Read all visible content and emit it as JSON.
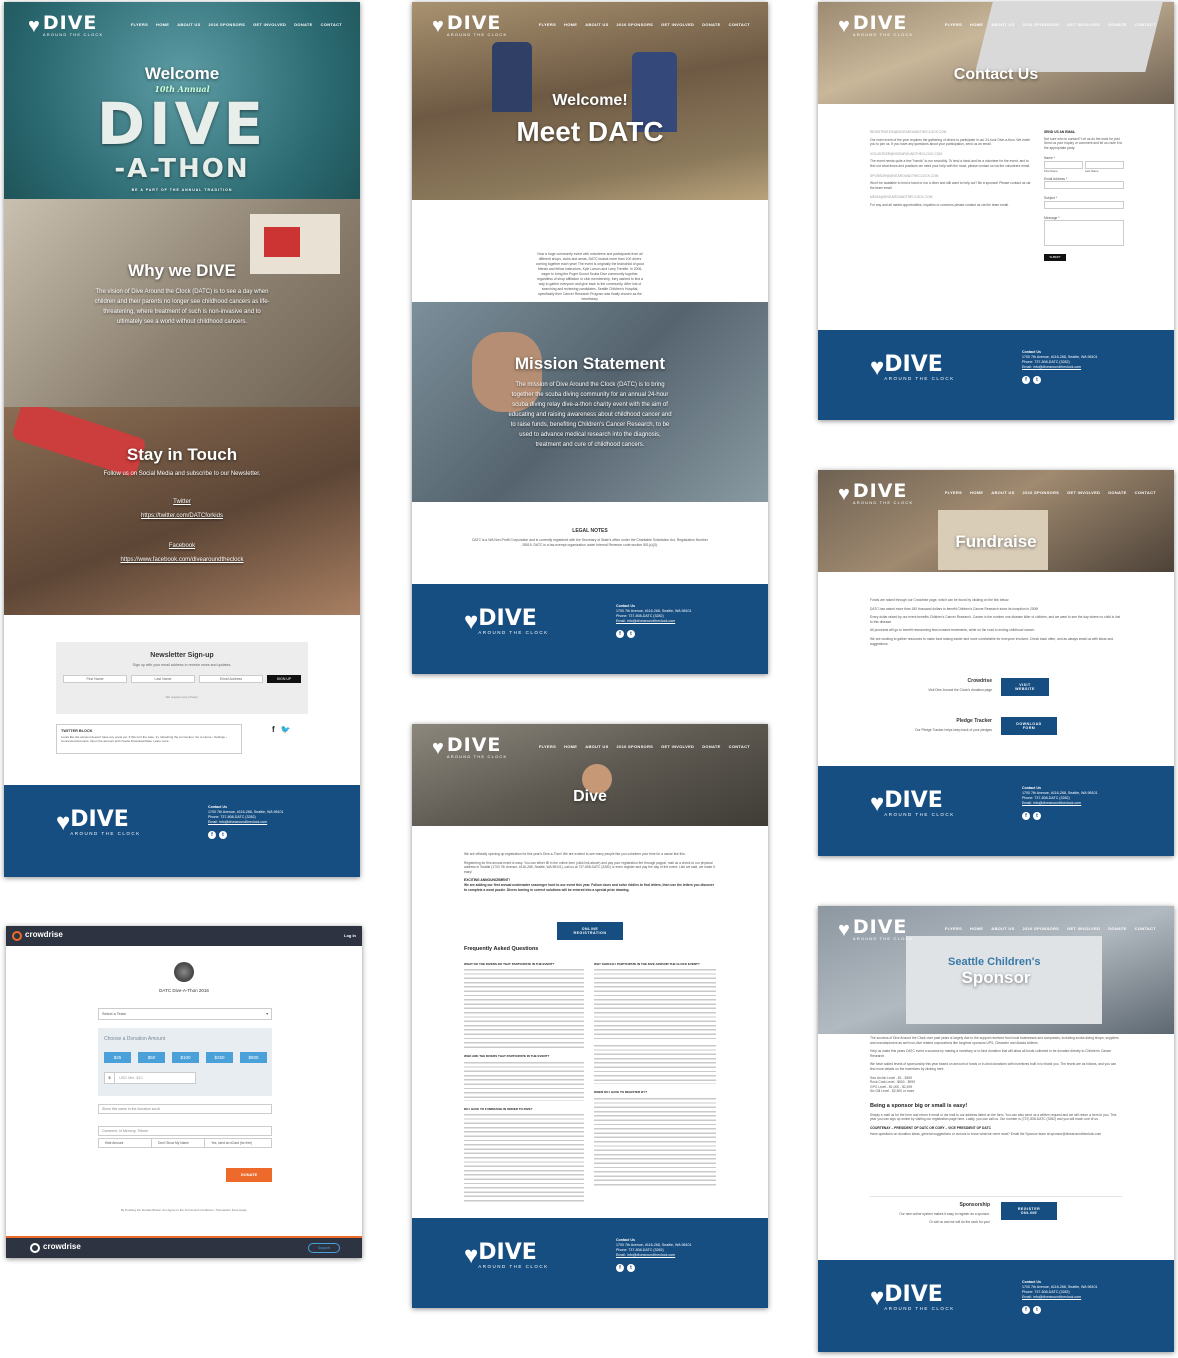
{
  "brand": {
    "name": "DIVE",
    "tagline": "AROUND THE CLOCK"
  },
  "nav": [
    "FLYERS",
    "HOME",
    "ABOUT US",
    "2016 SPONSORS",
    "GET INVOLVED",
    "DONATE",
    "CONTACT"
  ],
  "home": {
    "welcome": "Welcome",
    "annual": "10th Annual",
    "dive": "DIVE",
    "athon": "-A-THON",
    "be_part": "BE A PART OF THE ANNUAL TRADITION",
    "why_title": "Why we DIVE",
    "why_text": "The vision of Dive Around the Clock (DATC) is to see a day when children and their parents no longer see childhood cancers as life-threatening, where treatment of such is non-invasive and to ultimately see a world without childhood cancers.",
    "stay_title": "Stay in Touch",
    "stay_text": "Follow us on Social Media and subscribe to our Newsletter.",
    "twitter_label": "Twitter",
    "twitter_url": "https://twitter.com/DATCforkids",
    "facebook_label": "Facebook",
    "facebook_url": "https://www.facebook.com/divearoundtheclock",
    "newsletter_title": "Newsletter Sign-up",
    "newsletter_text": "Sign up with your email address to receive news and updates.",
    "first_name": "First Name",
    "last_name": "Last Name",
    "email_address": "Email Address",
    "signup": "SIGN UP",
    "privacy": "We respect your privacy.",
    "twitter_block_title": "TWITTER BLOCK",
    "twitter_block_text": "Looks like the account doesn't have any posts yet. If this isn't the case, try refreshing the connection. Go to Home › Settings › Connected Accounts. Open the account and choose Download Data. Learn more."
  },
  "about": {
    "welcome": "Welcome!",
    "title": "Meet DATC",
    "intro": "Now a huge community event with volunteers and participants from all different shops, clubs and areas, DATC boasts more than 100 divers coming together each year! The event is originally the brainchild of good friends and fellow instructors, Kyle Larson and Larry Trendle. In 2006, eager to bring the Puget Sound Scuba Dive community together, regardless of shop affiliation or club membership, they wanted to find a way to gather everyone and give back to the community. After lots of searching and reviewing candidates, Seattle Children's Hospital, specifically their Cancer Research Program was finally chosen as the beneficiary.",
    "mission_title": "Mission Statement",
    "mission_text": "The mission of Dive Around the Clock (DATC) is to bring together the scuba diving community for an annual 24-hour scuba diving relay dive-a-thon charity event with the aim of educating and raising awareness about childhood cancer and to raise funds, benefiting Children's Cancer Research, to be used to advance medical research into the diagnosis, treatment and cure of childhood cancers.",
    "legal_title": "LEGAL NOTES",
    "legal_text": "DATC is a WA Non-Profit Corporation and is currently registered with the Secretary of State's office under the Charitable Solicitation Act. Registration Number 28519. DATC is a tax-exempt organization under Internal Revenue code section 501(c)(3)."
  },
  "footer": {
    "contact_label": "Contact Us",
    "address": "1700 7th Avenue, #116-268, Seattle, WA 98101",
    "phone": "Phone: 737-808-DATC (3282)",
    "email": "Email: info@divearoundtheclock.com"
  },
  "contact": {
    "title": "Contact Us",
    "reg_email": "REGISTRATION@DIVEAROUNDTHECLOCK.COM",
    "reg_text": "Our main event of the year requires the gathering of divers to participate in our 24-hour Dive-a-thon. We invite you to join us. If you have any questions about your participation, send us an email.",
    "vol_email": "VOLUNTEER@DIVEAROUNDTHECLOCK.COM",
    "vol_text": "The event needs quite a few \"hands\" to run smoothly. To lend a hand and be a volunteer for the event, and to find out what times and positions we need your help with the most, please contact us via the volunteers email.",
    "spo_email": "SPONSOR@DIVEAROUNDTHECLOCK.COM",
    "spo_text": "Won't be available to lend a hand or run a diver and still want to help out? Be a sponsor! Please contact us via the team email.",
    "med_email": "MEDIA@DIVEAROUNDTHECLOCK.COM",
    "med_text": "For any and all media opportunities, inquiries or concerns please contact us via the team email.",
    "send_title": "SEND US AN EMAIL",
    "send_text": "Not sure who to contact? Let us do the work for you! Send us your inquiry or comment and let us route it to the appropriate party.",
    "name": "Name *",
    "first": "First Name",
    "last": "Last Name",
    "email": "Email Address *",
    "subject": "Subject *",
    "message": "Message *",
    "submit": "SUBMIT"
  },
  "fundraise": {
    "title": "Fundraise",
    "p1": "Funds are raised through our Crowdrise page, which can be found by clicking on the link below.",
    "p2": "DATC has raised more than 180 thousand dollars to benefit Children's Cancer Research since its inception in 2006!",
    "p3": "Every dollar raised by our event benefits Children's Cancer Research. Cancer is the number one disease killer of children, and we want to see the day where no child is lost to this disease.",
    "p4": "All proceeds will go to benefit researching less invasive treatments, while on the road to ending childhood cancer.",
    "p5": "We are working to gather resources to make fund raising easier and more comfortable for everyone involved. Check back often, and as always email us with ideas and suggestions.",
    "crowdrise_title": "Crowdrise",
    "crowdrise_text": "Visit Dive Around the Clock's donation page",
    "visit": "VISIT WEBSITE",
    "pledge_title": "Pledge Tracker",
    "pledge_text": "Our Pledge Tracker helps keep track of your pledges",
    "download": "DOWNLOAD FORM"
  },
  "dive": {
    "title": "Dive",
    "p1": "We are officially opening up registration for this year's Dive-a-Thon! We are excited to see many people like you volunteer your time for a cause like this.",
    "p2": "Registering for this annual event is easy. You can either fill in the online form (click link above) and pay your registration fee through paypal, mail us a check to our physical address in Seattle (1700 7th Avenue, #116-268, Seattle, WA 98101), call us at 737-808-DATC (3282) or even register and pay the day of the event. Like we said, we make it easy!",
    "exciting": "EXCITING ANNOUNCEMENT!",
    "p3": "We are adding our first annual underwater scavenger hunt to our event this year. Follow clues and solve riddles to find letters, then use the letters you discover to complete a word puzzle. Divers turning in correct solutions will be entered into a special prize drawing.",
    "register": "ONLINE REGISTRATION",
    "faq": "Frequently Asked Questions",
    "q1": "WHAT DO THE DIVERS DO THAT PARTICIPATE IN THE EVENT?",
    "q2": "WHY SHOULD I PARTICIPATE IN THE DIVE AROUND THE CLOCK EVENT?",
    "q3": "WHO ARE THE DIVERS THAT PARTICIPATE IN THE EVENT?",
    "q4": "WHO ELSE PARTICIPATES IN THE EVENT?",
    "q5": "DO I HAVE TO FUNDRAISE IN ORDER TO DIVE?",
    "q6": "WHEN DO I HAVE TO REGISTER BY?"
  },
  "sponsor": {
    "title": "Sponsor",
    "bg_sign": "Seattle Children's",
    "p1": "The success of Dive Around the Clock over past years is largely due to the support received from local businesses and companies, including scuba diving shops, suppliers and manufacturers as well non-dive related corporations like longtime sponsors UPS, Clearwire and Alaska Airlines.",
    "p2": "Help us make this years DATC event a success by making a monetary or in-kind donation that will allow all funds collected to be donated directly to Children's Cancer Research.",
    "p3": "We have added levels of sponsorship this year based on amount of funds or in-kind donations with incentives built in to thank you. The levels are as follows, and you can find more details on the incentives by clicking here.",
    "levels": [
      "Sea Urchin Level - $1 - $499",
      "Rock Crab Level - $500 - $999",
      "GPO Level - $1,000 - $2,499",
      "Six Gill Level - $2,500 or more"
    ],
    "big_small": "Being a sponsor big or small is easy!",
    "p4": "Simply e-mail us for the form and return it email or via mail to our address listed on the form. You can also send us a written request and we will return a form to you. This year you can sign up online by visiting our registration page here. Lastly, you can call us. Our number is (737) 808-DATC (3282) and you will reach one of us.",
    "courtenay": "COURTENAY – PRESIDENT OF DATC OR CORY – VICE PRESIDENT OF DATC",
    "p5": "Have questions on donation ideas, general suggestions or curious to know what we need most? Email the Sponsor team at sponsor@divearoundtheclock.com",
    "sp_title": "Sponsorship",
    "sp_text1": "Our new online system makes it easy to register as a sponsor.",
    "sp_text2": "Or call us and we will do the work for you!",
    "register": "REGISTER ONLINE"
  },
  "crowdrise": {
    "logo": "crowdrise",
    "login": "Log In",
    "event": "DATC Dive-A-Thon 2016",
    "select_team": "Select a Team",
    "choose": "Choose a Donation Amount",
    "amounts": [
      "$25",
      "$50",
      "$100",
      "$250",
      "$500"
    ],
    "currency": "$",
    "usd": "USD Min. $10",
    "show_name": "Show this name in the donation scroll",
    "comment": "Comment, In Memory, Tribute",
    "hide_amount": "Hide Amount",
    "dont_show": "Don't Show My Name",
    "ecard": "Yes, send an eCard (for free)",
    "donate": "DONATE",
    "terms": "By Pushing the Donate Button You Agree to the Terms and Conditions. Transaction Fees Apply.",
    "support": "Support"
  },
  "colors": {
    "navy": "#174e82",
    "teal": "#3f7f83",
    "orange": "#ee6a2a",
    "crowdrise_dark": "#2d3341",
    "crowdrise_blue": "#4aa0d8"
  }
}
